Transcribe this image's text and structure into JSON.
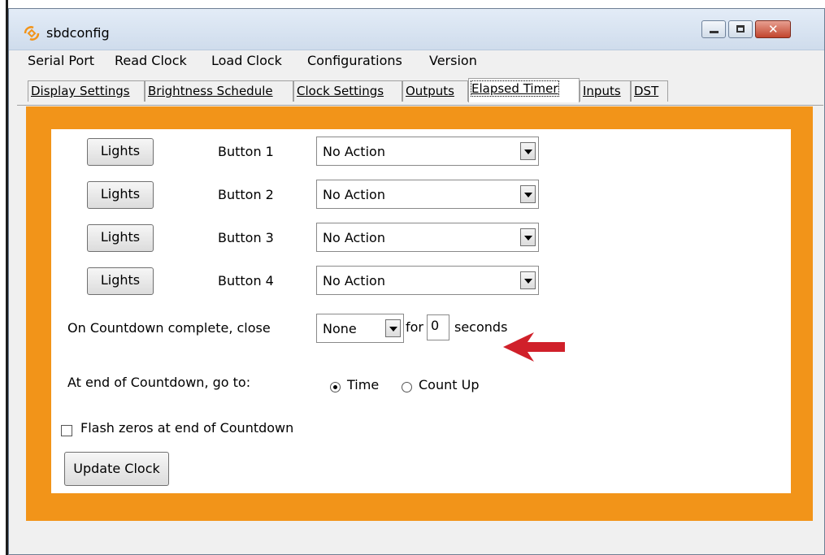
{
  "window": {
    "title": "sbdconfig",
    "icon": "sbdconfig-app-icon",
    "close_glyph": "✕"
  },
  "menu": [
    "Serial Port",
    "Read Clock",
    "Load Clock",
    "Configurations",
    "Version"
  ],
  "tabs": [
    "Display Settings",
    "Brightness Schedule",
    "Clock Settings",
    "Outputs",
    "Elapsed Timer",
    "Inputs",
    "DST"
  ],
  "active_tab": "Elapsed Timer",
  "buttons": [
    {
      "light_label": "Lights",
      "label": "Button 1",
      "action": "No Action"
    },
    {
      "light_label": "Lights",
      "label": "Button 2",
      "action": "No Action"
    },
    {
      "light_label": "Lights",
      "label": "Button 3",
      "action": "No Action"
    },
    {
      "light_label": "Lights",
      "label": "Button 4",
      "action": "No Action"
    }
  ],
  "countdown": {
    "close_label": "On Countdown complete, close",
    "close_value": "None",
    "for_label": "for",
    "seconds_value": "0",
    "seconds_label": "seconds",
    "goto_label": "At end of Countdown, go to:",
    "goto_options": [
      "Time",
      "Count Up"
    ],
    "goto_selected": "Time",
    "flash_label": "Flash zeros at end of Countdown",
    "flash_checked": false
  },
  "update_button": "Update Clock",
  "colors": {
    "accent": "#f29419",
    "arrow": "#d0202a"
  }
}
